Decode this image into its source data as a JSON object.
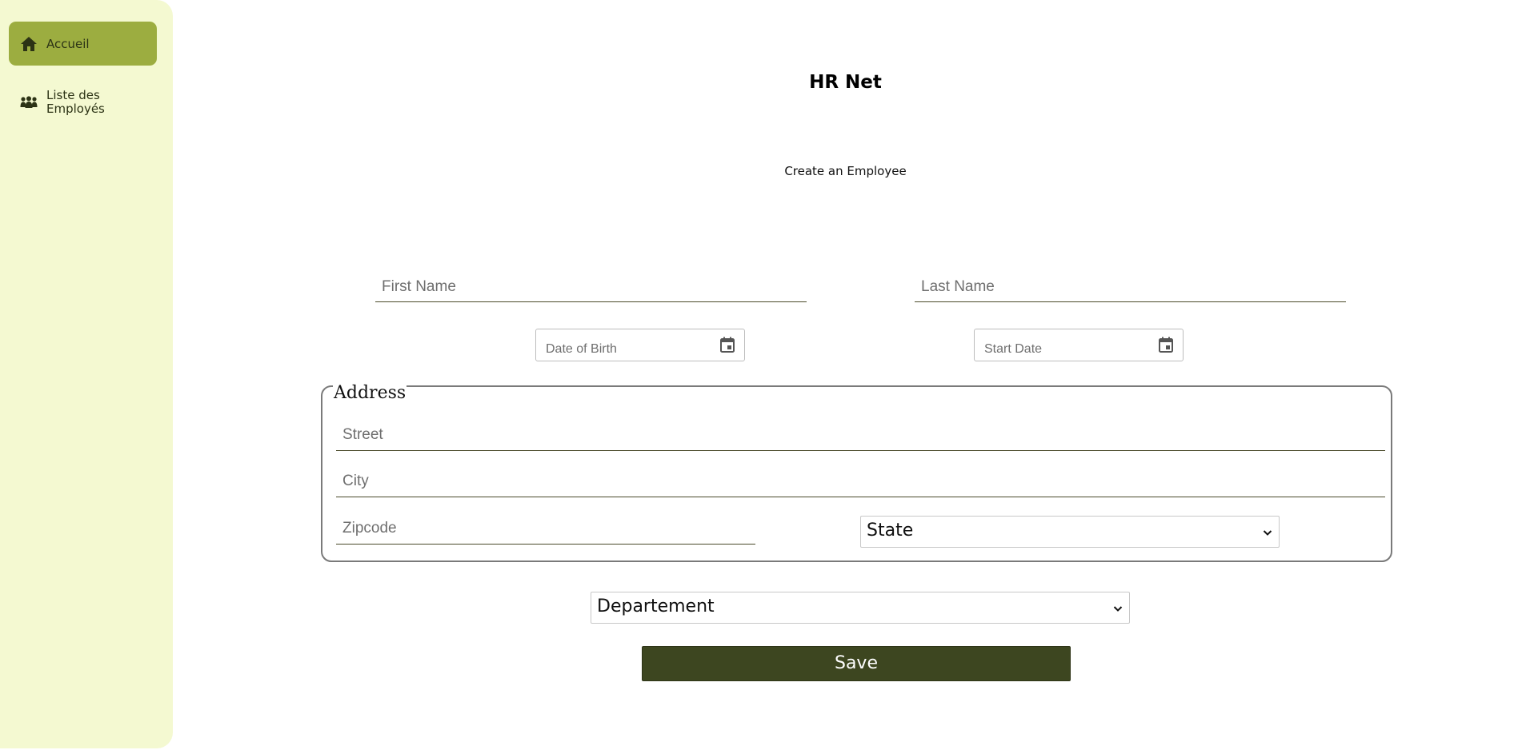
{
  "sidebar": {
    "items": [
      {
        "label": "Accueil",
        "icon": "home-icon",
        "active": true
      },
      {
        "label": "Liste des Employés",
        "icon": "people-icon",
        "active": false
      }
    ]
  },
  "header": {
    "title": "HR Net",
    "subtitle": "Create an Employee"
  },
  "form": {
    "first_name": {
      "value": "",
      "placeholder": "First Name"
    },
    "last_name": {
      "value": "",
      "placeholder": "Last Name"
    },
    "date_of_birth": {
      "value": "",
      "placeholder": "Date of Birth"
    },
    "start_date": {
      "value": "",
      "placeholder": "Start Date"
    },
    "address": {
      "legend": "Address",
      "street": {
        "value": "",
        "placeholder": "Street"
      },
      "city": {
        "value": "",
        "placeholder": "City"
      },
      "zipcode": {
        "value": "",
        "placeholder": "Zipcode"
      },
      "state": {
        "selected": "State"
      }
    },
    "department": {
      "selected": "Departement"
    },
    "save_label": "Save"
  },
  "colors": {
    "sidebar_bg": "#f4f9d1",
    "active_item_bg": "#9cad40",
    "save_button_bg": "#3d4620"
  }
}
